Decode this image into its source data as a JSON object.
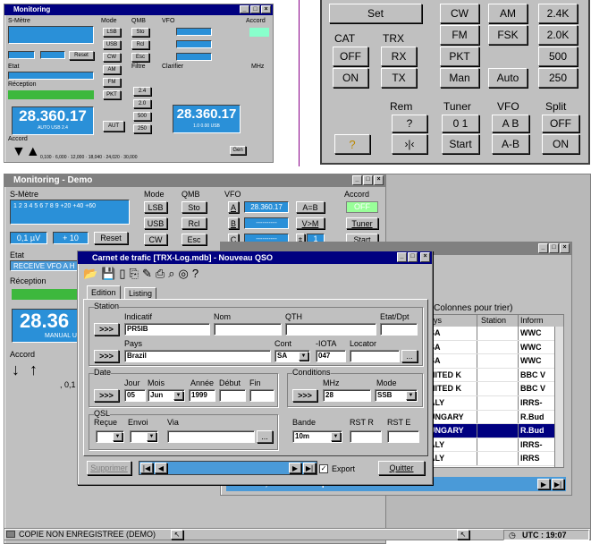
{
  "top_left_window": {
    "title": "Monitoring",
    "labels": [
      "S-Mètre",
      "Mode",
      "QMB",
      "VFO",
      "Accord",
      "Etat",
      "Filtre",
      "Clarifier",
      "Réception",
      "MHz",
      "Accord"
    ],
    "lcd_value": "28.360.17",
    "lcd_sub": "AUTO USB 2.4",
    "vfo_lcd": "28.360.17",
    "vfo_lcd_sub": "1.0 0.00 USB",
    "buttons": [
      "LSB",
      "USB",
      "CW",
      "AM",
      "FM",
      "PKT",
      "Sto",
      "Rcl",
      "Esc",
      "Reset",
      "Gen"
    ],
    "filters": [
      "2.4",
      "2.0",
      "500",
      "250"
    ],
    "small_values": [
      "0,100",
      "6,000",
      "12,000",
      "18,040",
      "24,020",
      "30,000"
    ]
  },
  "top_right_panel": {
    "buttons": [
      "Set",
      "CW",
      "AM",
      "2.4K",
      "FM",
      "FSK",
      "2.0K",
      "500",
      "PKT",
      "Man",
      "Auto",
      "250",
      "OFF",
      "ON",
      "RX",
      "TX",
      "?",
      "0 1",
      "A B",
      "OFF",
      "Start",
      "A-B",
      "ON"
    ],
    "group_labels": [
      "CAT",
      "TRX",
      "Rem",
      "Tuner",
      "VFO",
      "Split"
    ]
  },
  "main_window": {
    "title": "Monitoring - Demo",
    "smeter_label": "S-Mètre",
    "smeter_scale": "1 2 3 4 5 6 7 8 9 +20 +40 +60",
    "smeter_value": "0,1 µV",
    "smeter_db": "+ 10",
    "reset": "Reset",
    "mode_label": "Mode",
    "mode_buttons": [
      "LSB",
      "USB",
      "CW"
    ],
    "qmb_label": "QMB",
    "qmb_buttons": [
      "Sto",
      "Rcl",
      "Esc"
    ],
    "vfo_label": "VFO",
    "vfo_rows": [
      {
        "key": "A",
        "value": "28.360.17",
        "btn": "A=B"
      },
      {
        "key": "B",
        "value": "----------",
        "btn": "V>M"
      },
      {
        "key": "C",
        "value": "----------",
        "btn": "1"
      }
    ],
    "accord_label": "Accord",
    "accord_buttons": [
      "OFF",
      "Tuner",
      "Start"
    ],
    "etat_label": "Etat",
    "etat_value": "RECEIVE VFO A H",
    "reception_label": "Réception",
    "big_freq": "28.36",
    "big_freq_sub": "MANUAL U",
    "accord2_label": "Accord",
    "scale_val": ", 0,1",
    "status_text": "COPIE NON ENREGISTREE (DEMO)",
    "utc": "UTC : 19:07"
  },
  "bg_window": {
    "header": "r/Colonnes pour trier)",
    "columns": [
      "ays",
      "Station",
      "Inform"
    ],
    "rows": [
      [
        "SA",
        "",
        "WWC"
      ],
      [
        "SA",
        "",
        "WWC"
      ],
      [
        "SA",
        "",
        "WWC"
      ],
      [
        "NITED K",
        "",
        "BBC V"
      ],
      [
        "NITED K",
        "",
        "BBC V"
      ],
      [
        "ALY",
        "",
        "IRRS-"
      ],
      [
        "UNGARY",
        "",
        "R.Bud"
      ],
      [
        "UNGARY",
        "",
        "R.Bud"
      ],
      [
        "ALY",
        "",
        "IRRS-"
      ],
      [
        "ALY",
        "",
        "IRRS"
      ]
    ],
    "bottom_text": "0,575 : R.Budapest"
  },
  "dialog": {
    "title": "Carnet de trafic [TRX-Log.mdb] - Nouveau QSO",
    "tabs": [
      "Edition",
      "Listing"
    ],
    "station": {
      "label": "Station",
      "indicatif_label": "Indicatif",
      "indicatif": "PR5IB",
      "nom_label": "Nom",
      "qth_label": "QTH",
      "etat_label": "Etat/Dpt",
      "pays_label": "Pays",
      "pays": "Brazil",
      "cont_label": "Cont",
      "cont": "SA",
      "iota_label": "-IOTA",
      "iota": "047",
      "locator_label": "Locator"
    },
    "date": {
      "label": "Date",
      "jour_label": "Jour",
      "jour": "05",
      "mois_label": "Mois",
      "mois": "Jun",
      "annee_label": "Année",
      "annee": "1999",
      "debut_label": "Début",
      "fin_label": "Fin"
    },
    "conditions": {
      "label": "Conditions",
      "mhz_label": "MHz",
      "mhz": "28",
      "mode_label": "Mode",
      "mode": "SSB"
    },
    "qsl": {
      "label": "QSL",
      "recue_label": "Reçue",
      "envoi_label": "Envoi",
      "via_label": "Via"
    },
    "bande": {
      "label": "Bande",
      "value": "10m",
      "rstr_label": "RST R",
      "rste_label": "RST E"
    },
    "arrow_btn": ">>>",
    "dots": "...",
    "supprimer": "Supprimer",
    "export": "Export",
    "quitter": "Quitter"
  }
}
